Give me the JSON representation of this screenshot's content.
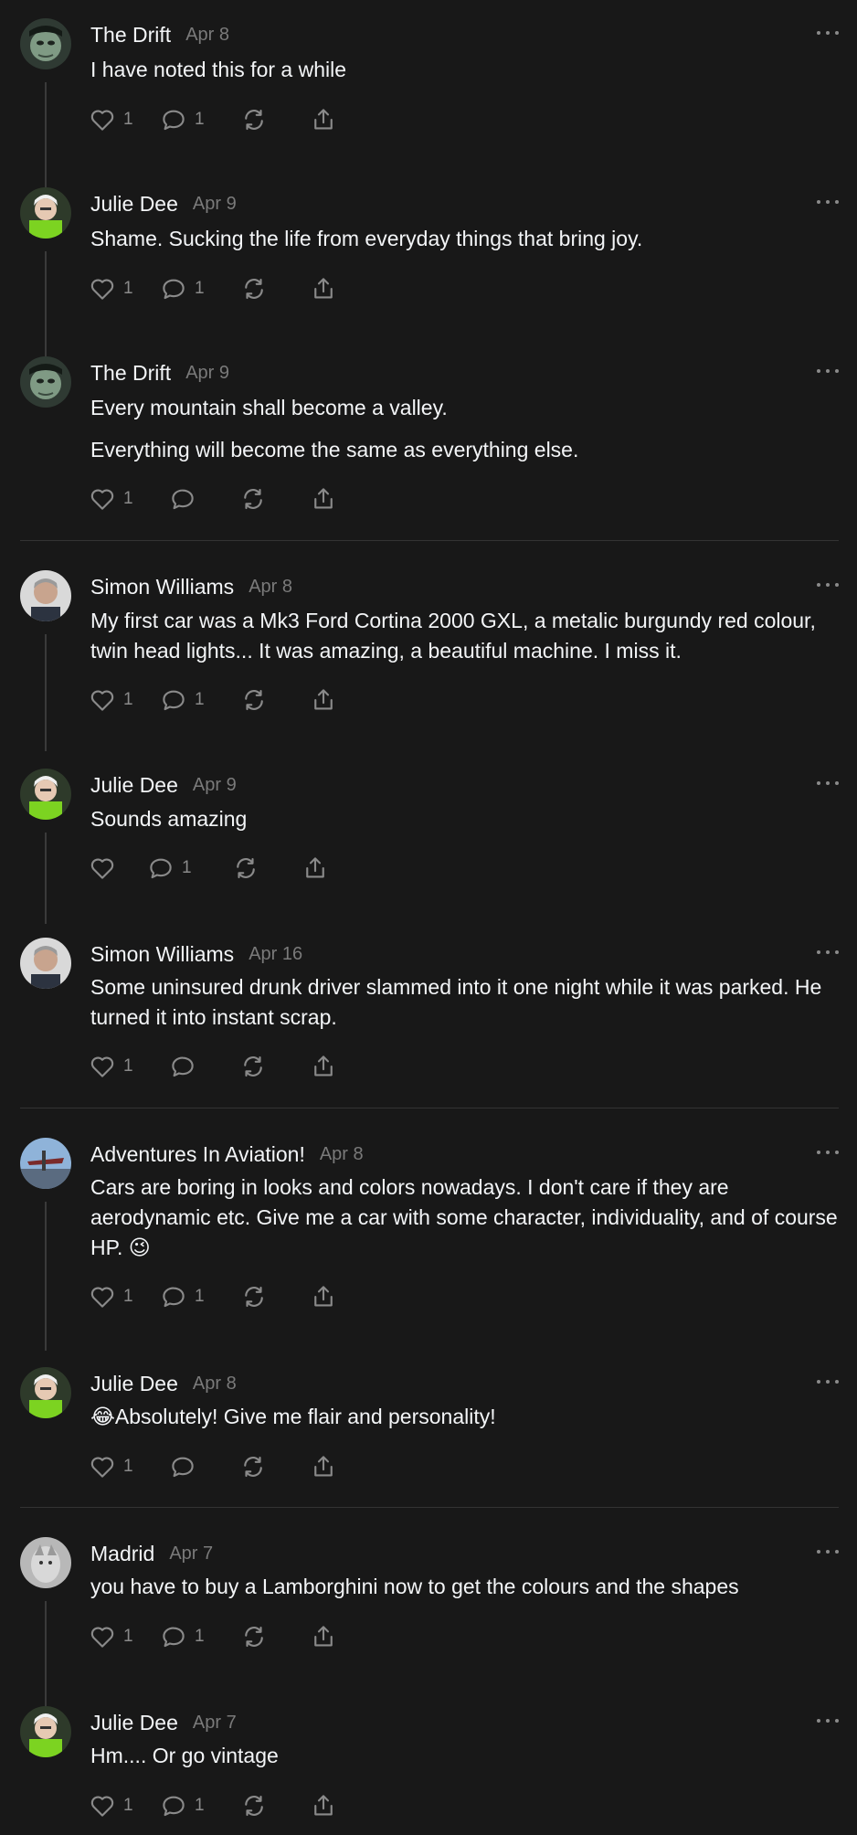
{
  "colors": {
    "background": "#181818",
    "text_primary": "#f3f5f7",
    "text_secondary": "#7a7a7a",
    "icon": "#8a8a8a",
    "thread_line": "#3a3a3a",
    "divider": "#333333"
  },
  "posts": [
    {
      "author": "The Drift",
      "date": "Apr 8",
      "lines": [
        "I have noted this for a while"
      ],
      "likes": "1",
      "replies": "1"
    },
    {
      "author": "Julie Dee",
      "date": "Apr 9",
      "lines": [
        "Shame. Sucking the life from everyday things that bring joy."
      ],
      "likes": "1",
      "replies": "1"
    },
    {
      "author": "The Drift",
      "date": "Apr 9",
      "lines": [
        "Every mountain shall become a valley.",
        "Everything will become the same as everything else."
      ],
      "likes": "1",
      "replies": ""
    },
    {
      "author": "Simon Williams",
      "date": "Apr 8",
      "lines": [
        "My first car was a Mk3 Ford Cortina 2000 GXL, a metalic burgundy red colour, twin head lights... It was amazing, a beautiful machine. I miss it."
      ],
      "likes": "1",
      "replies": "1"
    },
    {
      "author": "Julie Dee",
      "date": "Apr 9",
      "lines": [
        "Sounds amazing"
      ],
      "likes": "",
      "replies": "1"
    },
    {
      "author": "Simon Williams",
      "date": "Apr 16",
      "lines": [
        "Some uninsured drunk driver slammed into it one night while it was parked. He turned it into instant scrap."
      ],
      "likes": "1",
      "replies": ""
    },
    {
      "author": "Adventures In Aviation!",
      "date": "Apr 8",
      "lines": [
        "Cars are boring in looks and colors nowadays. I don't care if they are aerodynamic etc. Give me a car with some character, individuality, and of course HP. 😉"
      ],
      "likes": "1",
      "replies": "1"
    },
    {
      "author": "Julie Dee",
      "date": "Apr 8",
      "lines": [
        "😂Absolutely! Give me flair and personality!"
      ],
      "likes": "1",
      "replies": ""
    },
    {
      "author": "Madrid",
      "date": "Apr 7",
      "lines": [
        "you have to buy a Lamborghini now to get the colours and the shapes"
      ],
      "likes": "1",
      "replies": "1"
    },
    {
      "author": "Julie Dee",
      "date": "Apr 7",
      "lines": [
        "Hm.... Or go vintage"
      ],
      "likes": "1",
      "replies": "1"
    }
  ]
}
